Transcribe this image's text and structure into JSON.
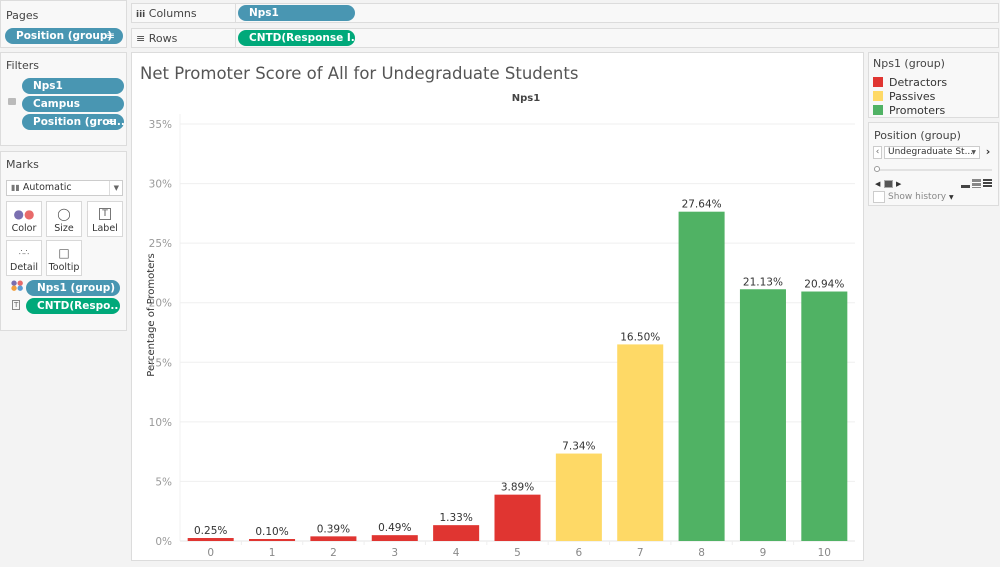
{
  "pages": {
    "title": "Pages",
    "pill": "Position (group)"
  },
  "filters": {
    "title": "Filters",
    "pills": [
      "Nps1",
      "Campus",
      "Position (grou.."
    ]
  },
  "marks": {
    "title": "Marks",
    "mark_type": "Automatic",
    "cards": [
      {
        "label": "Color",
        "icon": "color-dots-icon"
      },
      {
        "label": "Size",
        "icon": "size-icon"
      },
      {
        "label": "Label",
        "icon": "label-icon"
      },
      {
        "label": "Detail",
        "icon": "detail-icon"
      },
      {
        "label": "Tooltip",
        "icon": "tooltip-icon"
      }
    ],
    "fields": [
      {
        "label": "Nps1 (group)",
        "icon": "color-dots-icon"
      },
      {
        "label": "CNTD(Respo.. Δ",
        "icon": "label-icon"
      }
    ]
  },
  "shelves": {
    "columns": {
      "label": "Columns",
      "pill": "Nps1"
    },
    "rows": {
      "label": "Rows",
      "pill": "CNTD(Response I..  Δ"
    }
  },
  "legend": {
    "title": "Nps1 (group)",
    "items": [
      {
        "label": "Detractors",
        "color": "#e03531"
      },
      {
        "label": "Passives",
        "color": "#fed966"
      },
      {
        "label": "Promoters",
        "color": "#50b264"
      }
    ]
  },
  "page_control": {
    "title": "Position (group)",
    "value": "Undegraduate St...",
    "show_history": "Show history"
  },
  "chart_data": {
    "type": "bar",
    "title": "Net Promoter Score of All for Undegraduate Students",
    "column_header": "Nps1",
    "xlabel": "",
    "ylabel": "Percentage of Promoters",
    "categories": [
      "0",
      "1",
      "2",
      "3",
      "4",
      "5",
      "6",
      "7",
      "8",
      "9",
      "10"
    ],
    "values": [
      0.25,
      0.1,
      0.39,
      0.49,
      1.33,
      3.89,
      7.34,
      16.5,
      27.64,
      21.13,
      20.94
    ],
    "labels": [
      "0.25%",
      "0.10%",
      "0.39%",
      "0.49%",
      "1.33%",
      "3.89%",
      "7.34%",
      "16.50%",
      "27.64%",
      "21.13%",
      "20.94%"
    ],
    "groups": [
      "Detractors",
      "Detractors",
      "Detractors",
      "Detractors",
      "Detractors",
      "Detractors",
      "Passives",
      "Passives",
      "Promoters",
      "Promoters",
      "Promoters"
    ],
    "group_colors": {
      "Detractors": "#e03531",
      "Passives": "#fed966",
      "Promoters": "#50b264"
    },
    "yticks": [
      0,
      5,
      10,
      15,
      20,
      25,
      30,
      35
    ],
    "ytick_labels": [
      "0%",
      "5%",
      "10%",
      "15%",
      "20%",
      "25%",
      "30%",
      "35%"
    ],
    "ylim": [
      0,
      35
    ],
    "grid": true,
    "legend_position": "right"
  }
}
